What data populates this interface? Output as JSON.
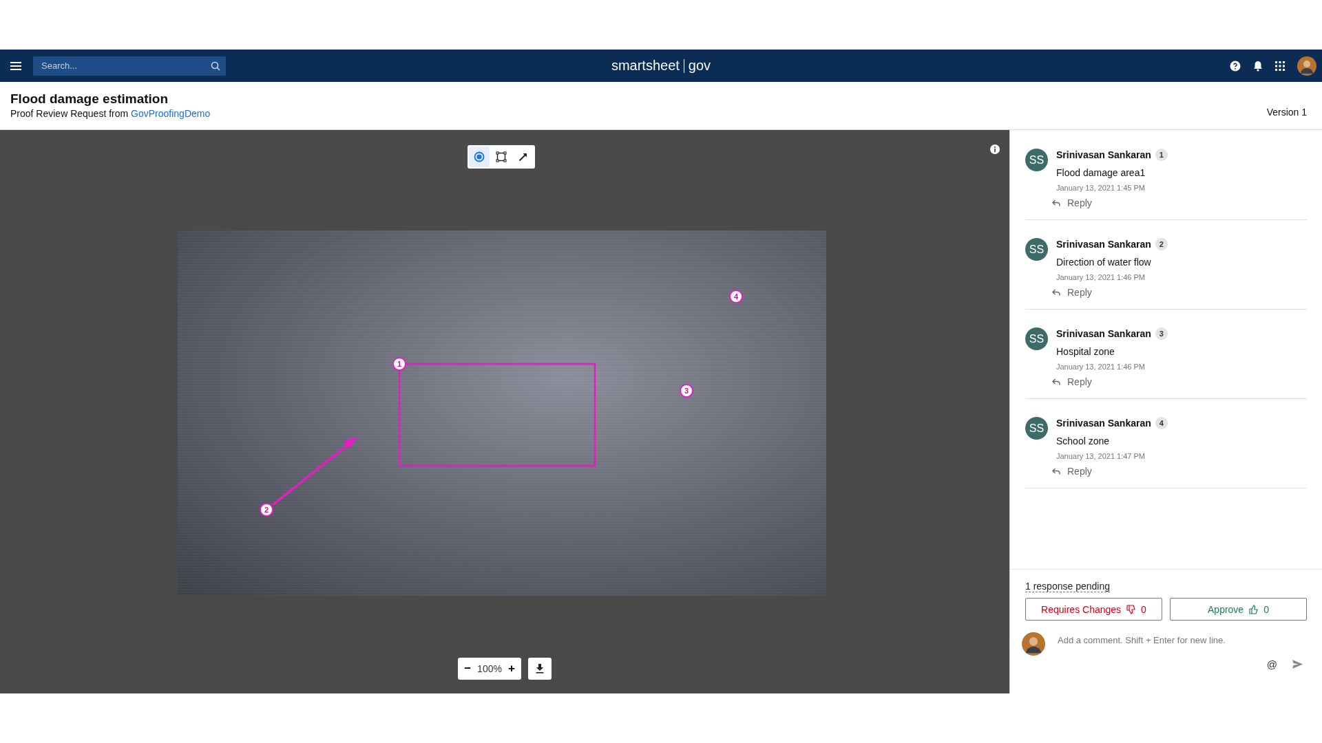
{
  "navbar": {
    "search": {
      "placeholder": "Search..."
    },
    "logo": {
      "brand": "smartsheet",
      "suffix": "gov"
    }
  },
  "header": {
    "title": "Flood damage estimation",
    "subtitle": "Proof Review Request from ",
    "requester": "GovProofingDemo",
    "version": "Version 1"
  },
  "tools": [
    {
      "kind": "point",
      "selected": true
    },
    {
      "kind": "rect",
      "selected": false
    },
    {
      "kind": "arrow",
      "selected": false
    }
  ],
  "annotations": [
    {
      "kind": "rect",
      "label": "1"
    },
    {
      "kind": "arrow",
      "label": "2"
    },
    {
      "kind": "point",
      "label": "3"
    },
    {
      "kind": "point",
      "label": "4"
    }
  ],
  "zoom": {
    "minus": "−",
    "value": "100%",
    "plus": "+"
  },
  "comments": [
    {
      "initials": "SS",
      "author": "Srinivasan Sankaran",
      "number": "1",
      "text": "Flood damage area1",
      "time": "January 13, 2021 1:45 PM",
      "reply": "Reply"
    },
    {
      "initials": "SS",
      "author": "Srinivasan Sankaran",
      "number": "2",
      "text": "Direction of water flow",
      "time": "January 13, 2021 1:46 PM",
      "reply": "Reply"
    },
    {
      "initials": "SS",
      "author": "Srinivasan Sankaran",
      "number": "3",
      "text": "Hospital zone",
      "time": "January 13, 2021 1:46 PM",
      "reply": "Reply"
    },
    {
      "initials": "SS",
      "author": "Srinivasan Sankaran",
      "number": "4",
      "text": "School zone",
      "time": "January 13, 2021 1:47 PM",
      "reply": "Reply"
    }
  ],
  "review": {
    "pending": "1 response pending",
    "requires_changes": {
      "label": "Requires Changes",
      "count": "0"
    },
    "approve": {
      "label": "Approve",
      "count": "0"
    }
  },
  "composer": {
    "placeholder": "Add a comment. Shift + Enter for new line.",
    "mention": "@"
  }
}
